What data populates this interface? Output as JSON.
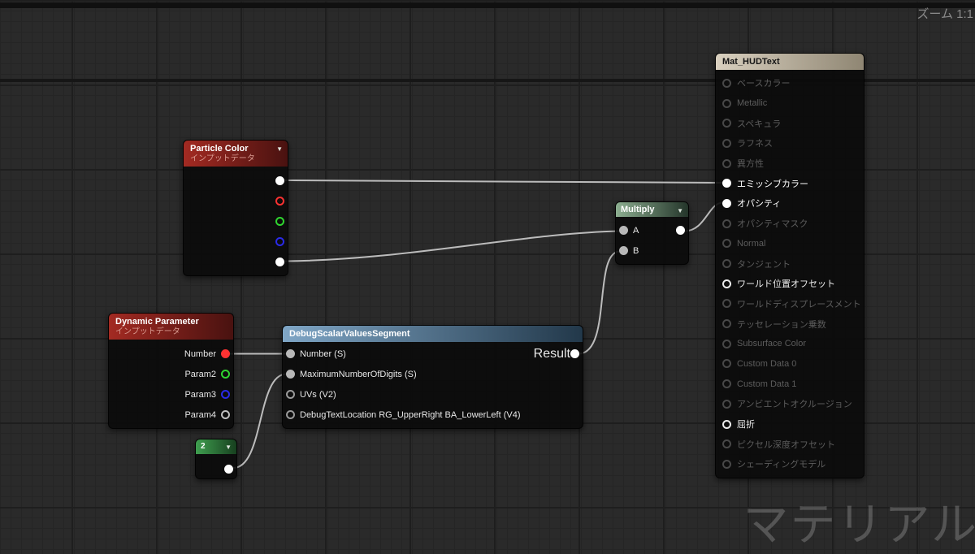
{
  "viewport": {
    "zoom_label": "ズーム 1:1",
    "watermark": "マテリアル",
    "background_color": "#2a2a2a",
    "wire_color": "#c9c9c9"
  },
  "nodes": {
    "particle_color": {
      "title": "Particle Color",
      "subtitle": "インプットデータ",
      "header_color": "#a32a22",
      "pins": [
        {
          "name": "rgb",
          "color": "#ffffff",
          "connected": true
        },
        {
          "name": "r",
          "color": "#ff3232",
          "connected": false
        },
        {
          "name": "g",
          "color": "#2fd52f",
          "connected": false
        },
        {
          "name": "b",
          "color": "#2a2ae8",
          "connected": false
        },
        {
          "name": "a",
          "color": "#ffffff",
          "connected": true
        }
      ]
    },
    "dynamic_parameter": {
      "title": "Dynamic Parameter",
      "subtitle": "インプットデータ",
      "header_color": "#a32a22",
      "pins": [
        {
          "label": "Number",
          "color": "#ff3232",
          "connected": true
        },
        {
          "label": "Param2",
          "color": "#2fd52f",
          "connected": false
        },
        {
          "label": "Param3",
          "color": "#2a2ae8",
          "connected": false
        },
        {
          "label": "Param4",
          "color": "#c0c0c0",
          "connected": false
        }
      ]
    },
    "debug_scalar": {
      "title": "DebugScalarValuesSegment",
      "header_color": "#7fa6c6",
      "inputs": [
        {
          "label": "Number (S)",
          "connected": true
        },
        {
          "label": "MaximumNumberOfDigits (S)",
          "connected": true
        },
        {
          "label": "UVs (V2)",
          "connected": false
        },
        {
          "label": "DebugTextLocation RG_UpperRight BA_LowerLeft (V4)",
          "connected": false
        }
      ],
      "output": {
        "label": "Result",
        "connected": true
      }
    },
    "multiply": {
      "title": "Multiply",
      "header_color": "#8cae90",
      "inputs": [
        {
          "label": "A",
          "connected": true
        },
        {
          "label": "B",
          "connected": true
        }
      ]
    },
    "constant": {
      "value": "2",
      "header_color": "#3f9e4f"
    },
    "material": {
      "title": "Mat_HUDText",
      "header_color": "#d9d0bf",
      "pins": [
        {
          "label": "ベースカラー",
          "state": "dim"
        },
        {
          "label": "Metallic",
          "state": "dim"
        },
        {
          "label": "スペキュラ",
          "state": "dim"
        },
        {
          "label": "ラフネス",
          "state": "dim"
        },
        {
          "label": "異方性",
          "state": "dim"
        },
        {
          "label": "エミッシブカラー",
          "state": "connected"
        },
        {
          "label": "オパシティ",
          "state": "connected"
        },
        {
          "label": "オパシティマスク",
          "state": "dim"
        },
        {
          "label": "Normal",
          "state": "dim"
        },
        {
          "label": "タンジェント",
          "state": "dim"
        },
        {
          "label": "ワールド位置オフセット",
          "state": "enabled"
        },
        {
          "label": "ワールドディスプレースメント",
          "state": "dim"
        },
        {
          "label": "テッセレーション乗数",
          "state": "dim"
        },
        {
          "label": "Subsurface Color",
          "state": "dim"
        },
        {
          "label": "Custom Data 0",
          "state": "dim"
        },
        {
          "label": "Custom Data 1",
          "state": "dim"
        },
        {
          "label": "アンビエントオクルージョン",
          "state": "dim"
        },
        {
          "label": "屈折",
          "state": "enabled"
        },
        {
          "label": "ピクセル深度オフセット",
          "state": "dim"
        },
        {
          "label": "シェーディングモデル",
          "state": "dim"
        }
      ]
    }
  },
  "wires": [
    {
      "from": "particle_color.rgb",
      "to": "material.emissive"
    },
    {
      "from": "particle_color.a",
      "to": "multiply.A"
    },
    {
      "from": "multiply.out",
      "to": "material.opacity"
    },
    {
      "from": "dynamic_parameter.Number",
      "to": "debug_scalar.Number (S)"
    },
    {
      "from": "constant.out",
      "to": "debug_scalar.MaximumNumberOfDigits (S)"
    },
    {
      "from": "debug_scalar.Result",
      "to": "multiply.B"
    }
  ]
}
